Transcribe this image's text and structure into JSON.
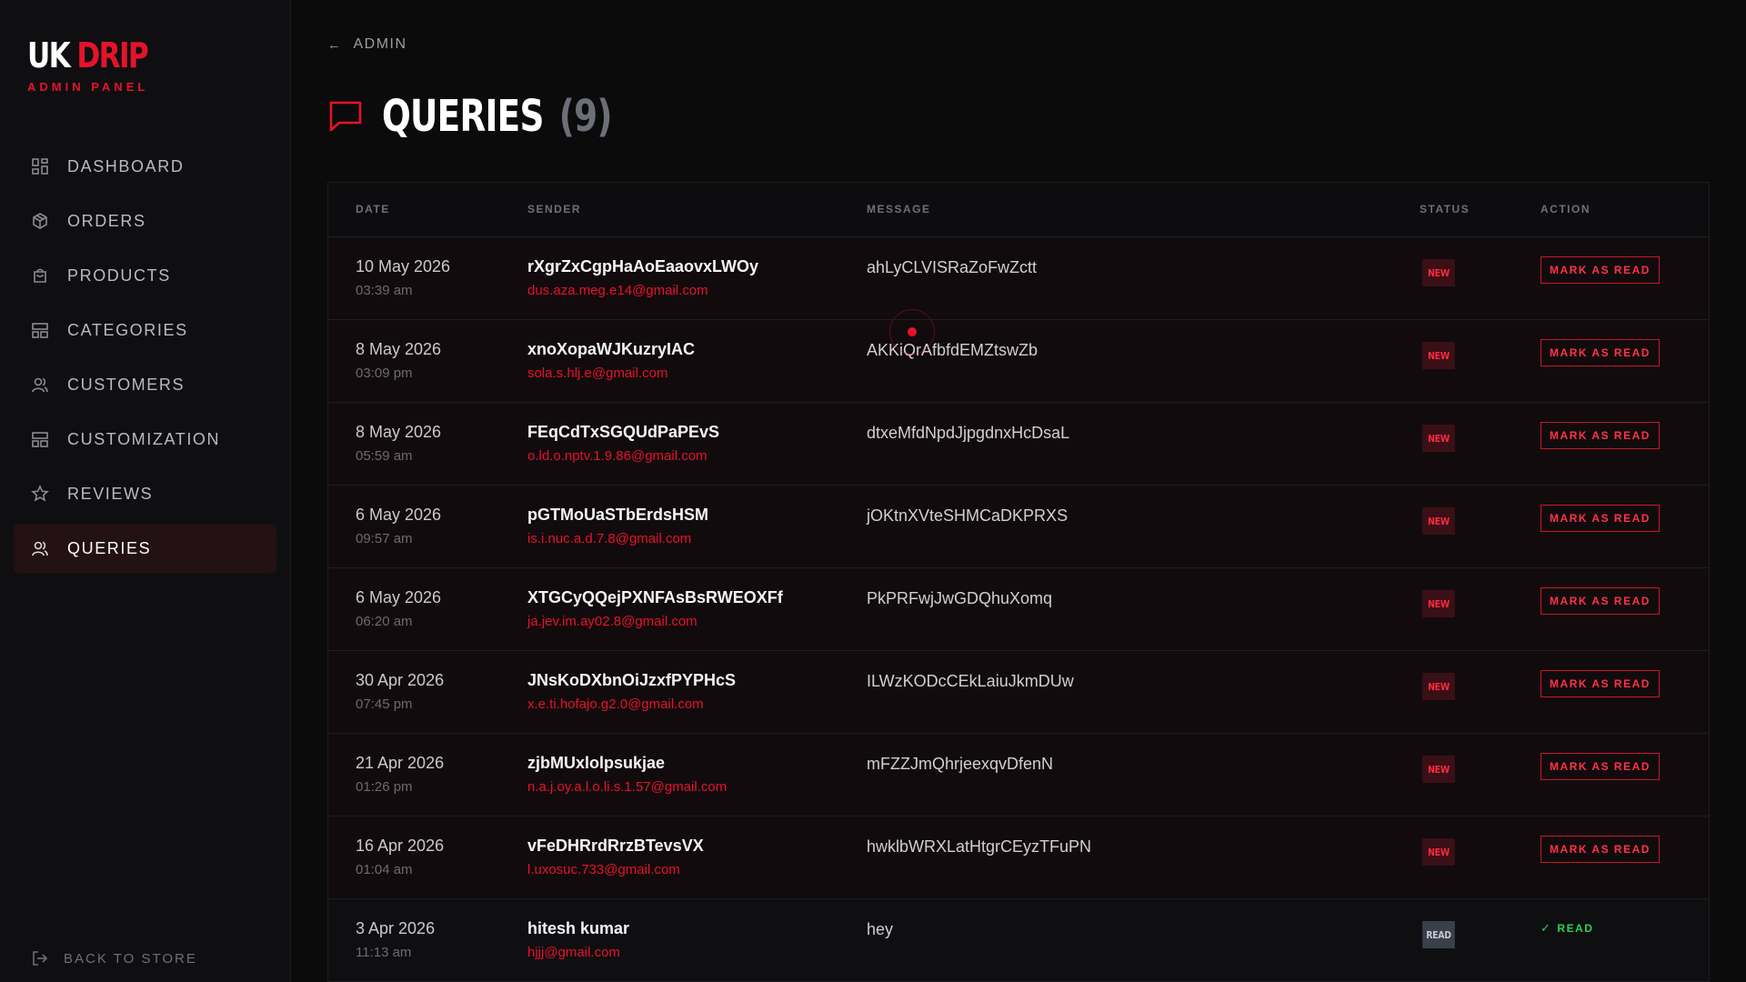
{
  "brand": {
    "title_main": "UK",
    "title_accent": "DRIP",
    "subtitle": "ADMIN PANEL"
  },
  "nav": [
    {
      "label": "DASHBOARD",
      "icon": "dashboard-grid-icon",
      "active": false
    },
    {
      "label": "ORDERS",
      "icon": "box-icon",
      "active": false
    },
    {
      "label": "PRODUCTS",
      "icon": "shopping-bag-icon",
      "active": false
    },
    {
      "label": "CATEGORIES",
      "icon": "layout-icon",
      "active": false
    },
    {
      "label": "CUSTOMERS",
      "icon": "users-icon",
      "active": false
    },
    {
      "label": "CUSTOMIZATION",
      "icon": "layout-icon",
      "active": false
    },
    {
      "label": "REVIEWS",
      "icon": "star-icon",
      "active": false
    },
    {
      "label": "QUERIES",
      "icon": "users-icon",
      "active": true
    }
  ],
  "back_to_store": "BACK TO STORE",
  "breadcrumb": {
    "label": "ADMIN"
  },
  "page": {
    "title": "QUERIES",
    "count": "(9)"
  },
  "table": {
    "headers": {
      "date": "DATE",
      "sender": "SENDER",
      "message": "MESSAGE",
      "status": "STATUS",
      "action": "ACTION"
    },
    "action_label": "MARK AS READ",
    "read_label": "READ",
    "rows": [
      {
        "date": "10 May 2026",
        "time": "03:39 am",
        "name": "rXgrZxCgpHaAoEaaovxLWOy",
        "email": "dus.aza.meg.e14@gmail.com",
        "message": "ahLyCLVISRaZoFwZctt",
        "status": "NEW"
      },
      {
        "date": "8 May 2026",
        "time": "03:09 pm",
        "name": "xnoXopaWJKuzryIAC",
        "email": "sola.s.hlj.e@gmail.com",
        "message": "AKKiQrAfbfdEMZtswZb",
        "status": "NEW"
      },
      {
        "date": "8 May 2026",
        "time": "05:59 am",
        "name": "FEqCdTxSGQUdPaPEvS",
        "email": "o.ld.o.nptv.1.9.86@gmail.com",
        "message": "dtxeMfdNpdJjpgdnxHcDsaL",
        "status": "NEW"
      },
      {
        "date": "6 May 2026",
        "time": "09:57 am",
        "name": "pGTMoUaSTbErdsHSM",
        "email": "is.i.nuc.a.d.7.8@gmail.com",
        "message": "jOKtnXVteSHMCaDKPRXS",
        "status": "NEW"
      },
      {
        "date": "6 May 2026",
        "time": "06:20 am",
        "name": "XTGCyQQejPXNFAsBsRWEOXFf",
        "email": "ja.jev.im.ay02.8@gmail.com",
        "message": "PkPRFwjJwGDQhuXomq",
        "status": "NEW"
      },
      {
        "date": "30 Apr 2026",
        "time": "07:45 pm",
        "name": "JNsKoDXbnOiJzxfPYPHcS",
        "email": "x.e.ti.hofajo.g2.0@gmail.com",
        "message": "ILWzKODcCEkLaiuJkmDUw",
        "status": "NEW"
      },
      {
        "date": "21 Apr 2026",
        "time": "01:26 pm",
        "name": "zjbMUxlolpsukjae",
        "email": "n.a.j.oy.a.l.o.li.s.1.57@gmail.com",
        "message": "mFZZJmQhrjeexqvDfenN",
        "status": "NEW"
      },
      {
        "date": "16 Apr 2026",
        "time": "01:04 am",
        "name": "vFeDHRrdRrzBTevsVX",
        "email": "l.uxosuc.733@gmail.com",
        "message": "hwklbWRXLatHtgrCEyzTFuPN",
        "status": "NEW"
      },
      {
        "date": "3 Apr 2026",
        "time": "11:13 am",
        "name": "hitesh kumar",
        "email": "hjjj@gmail.com",
        "message": "hey",
        "status": "READ"
      }
    ]
  },
  "colors": {
    "accent": "#e5132a",
    "background": "#0b0b0c",
    "read_green": "#2fcf5a"
  }
}
